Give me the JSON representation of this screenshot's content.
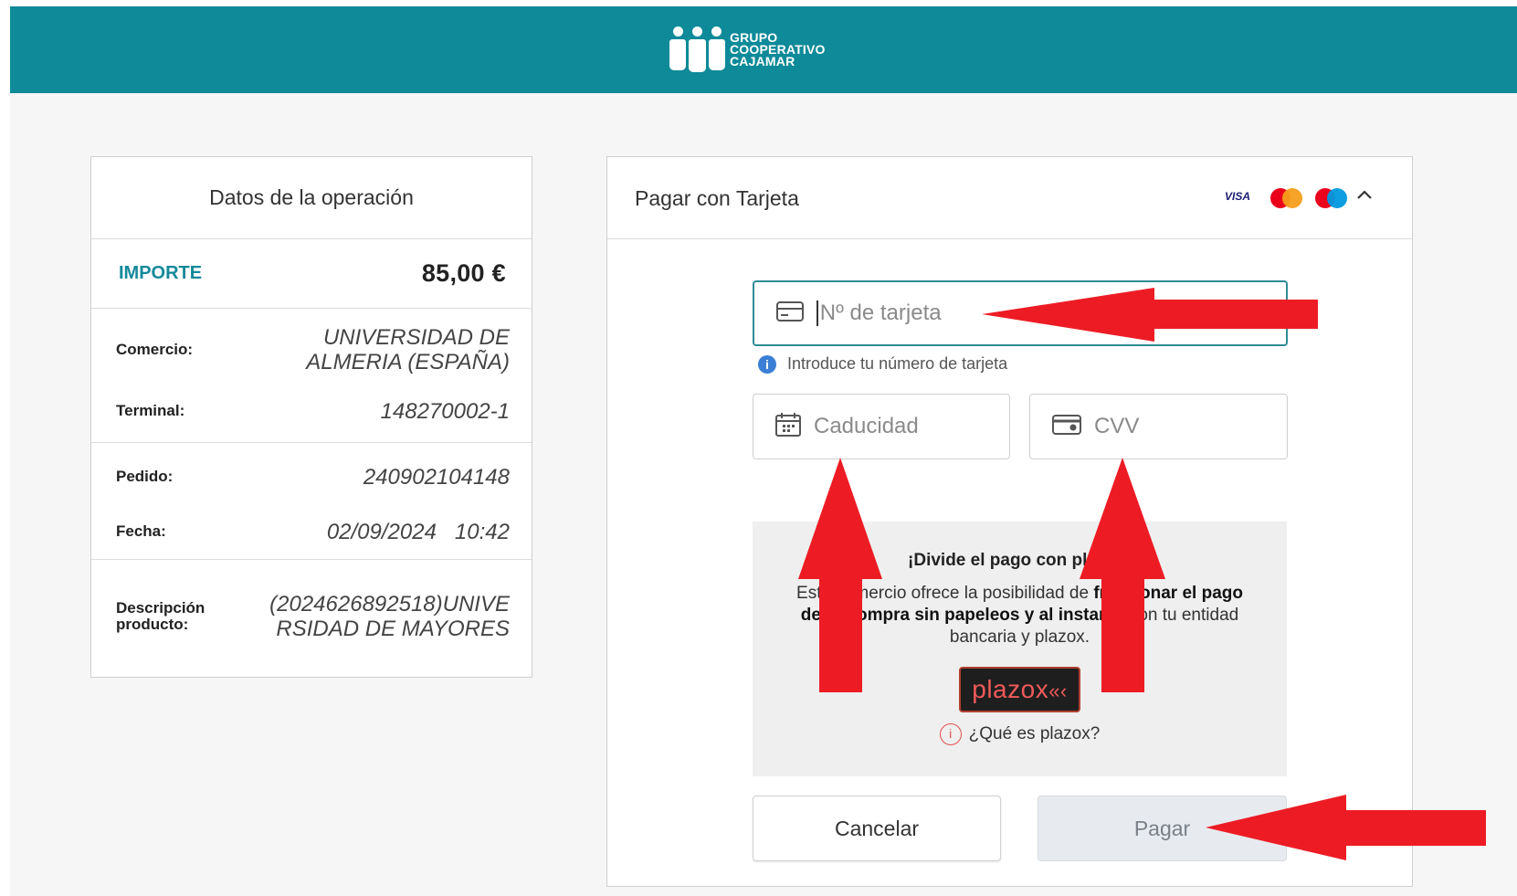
{
  "header": {
    "logo_lines": [
      "GRUPO",
      "COOPERATIVO",
      "CAJAMAR"
    ],
    "background_color": "#0e8a99"
  },
  "operation": {
    "title": "Datos de la operación",
    "amount_label": "IMPORTE",
    "amount_value": "85,00 €",
    "rows": {
      "comercio": {
        "label": "Comercio:",
        "value": "UNIVERSIDAD DE ALMERIA (ESPAÑA)"
      },
      "terminal": {
        "label": "Terminal:",
        "value": "148270002-1"
      },
      "pedido": {
        "label": "Pedido:",
        "value": "240902104148"
      },
      "fecha": {
        "label": "Fecha:",
        "value": "02/09/2024   10:42"
      },
      "descripcion": {
        "label": "Descripción producto:",
        "value": "(2024626892518)UNIVERSIDAD DE MAYORES"
      }
    }
  },
  "payment": {
    "title": "Pagar con Tarjeta",
    "brands": [
      "VISA",
      "mastercard",
      "maestro"
    ],
    "collapse_icon": "chevron-up-icon",
    "card_number": {
      "placeholder": "Nº de tarjeta",
      "value": "",
      "icon": "credit-card-icon"
    },
    "card_hint": "Introduce tu número de tarjeta",
    "expiry": {
      "placeholder": "Caducidad",
      "value": "",
      "icon": "calendar-icon"
    },
    "cvv": {
      "placeholder": "CVV",
      "value": "",
      "icon": "card-cvv-icon"
    },
    "promo": {
      "title": "¡Divide el pago con plazox!",
      "text_before": "Este comercio ofrece la posibilidad de ",
      "text_bold": "fraccionar el pago de tu compra sin papeleos y al instante",
      "text_after": " con tu entidad bancaria y plazox.",
      "logo_text": "plazox",
      "link": "¿Qué es plazox?"
    },
    "cancel_label": "Cancelar",
    "pay_label": "Pagar"
  },
  "annotation_color": "#ed1c24"
}
